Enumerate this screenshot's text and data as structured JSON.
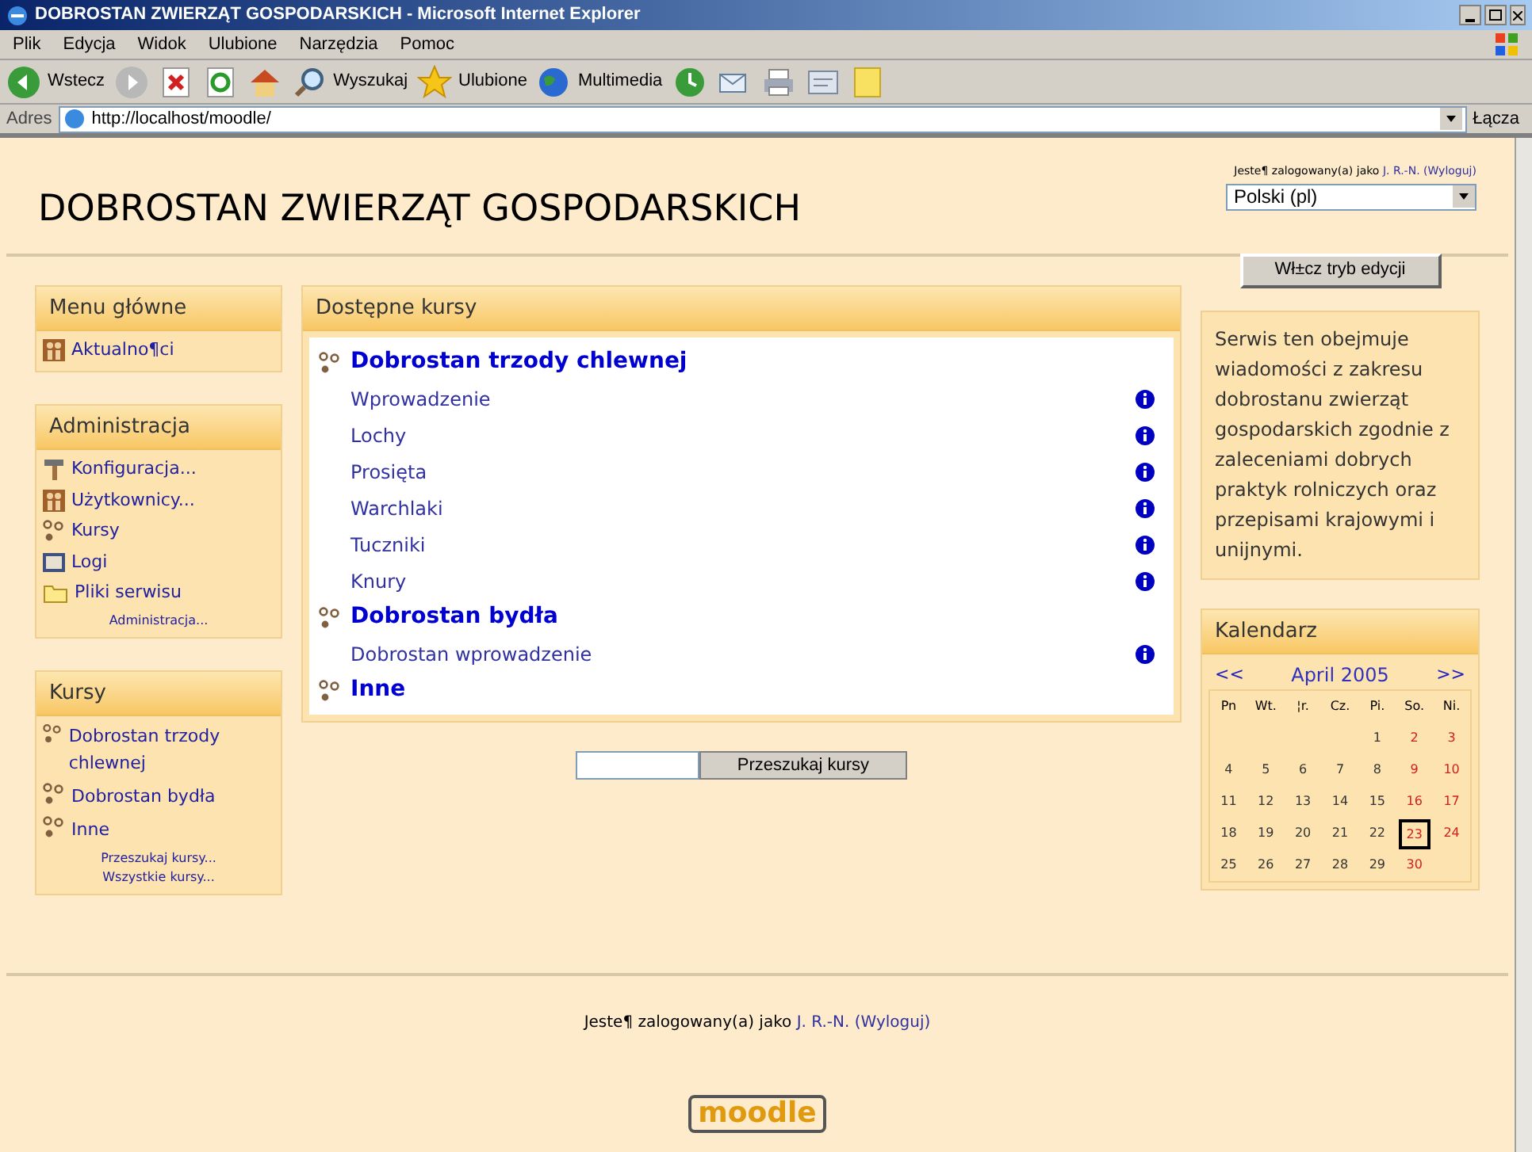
{
  "window": {
    "title": "DOBROSTAN ZWIERZĄT GOSPODARSKICH - Microsoft Internet Explorer"
  },
  "menu": [
    "Plik",
    "Edycja",
    "Widok",
    "Ulubione",
    "Narzędzia",
    "Pomoc"
  ],
  "toolbar": [
    {
      "kind": "back",
      "label": "Wstecz"
    },
    {
      "kind": "forward"
    },
    {
      "kind": "stop"
    },
    {
      "kind": "refresh"
    },
    {
      "kind": "home"
    },
    {
      "kind": "search",
      "label": "Wyszukaj"
    },
    {
      "kind": "favorites",
      "label": "Ulubione"
    },
    {
      "kind": "media",
      "label": "Multimedia"
    },
    {
      "kind": "history"
    },
    {
      "kind": "mail"
    },
    {
      "kind": "print"
    },
    {
      "kind": "edit"
    },
    {
      "kind": "notes"
    }
  ],
  "address": {
    "label": "Adres",
    "value": "http://localhost/moodle/",
    "links": "Łącza"
  },
  "site_title": "DOBROSTAN ZWIERZĄT GOSPODARSKICH",
  "login": {
    "prefix": "Jeste¶ zalogowany(a) jako",
    "user": "J. R.-N.",
    "logout": "(Wyloguj)"
  },
  "language": "Polski (pl)",
  "main_menu": {
    "title": "Menu główne",
    "items": [
      {
        "kind": "people",
        "label": "Aktualno¶ci"
      }
    ]
  },
  "admin": {
    "title": "Administracja",
    "items": [
      {
        "kind": "hammer",
        "label": "Konfiguracja..."
      },
      {
        "kind": "people",
        "label": "Użytkownicy..."
      },
      {
        "kind": "course",
        "label": "Kursy"
      },
      {
        "kind": "log",
        "label": "Logi"
      },
      {
        "kind": "folder",
        "label": "Pliki serwisu"
      }
    ],
    "more": "Administracja..."
  },
  "courses_block": {
    "title": "Kursy",
    "items": [
      "Dobrostan trzody chlewnej",
      "Dobrostan bydła",
      "Inne"
    ],
    "links": [
      "Przeszukaj kursy...",
      "Wszystkie kursy..."
    ]
  },
  "available": {
    "title": "Dostępne kursy",
    "categories": [
      {
        "name": "Dobrostan trzody chlewnej",
        "courses": [
          "Wprowadzenie",
          "Lochy",
          "Prosięta",
          "Warchlaki",
          "Tuczniki",
          "Knury"
        ]
      },
      {
        "name": "Dobrostan bydła",
        "courses": [
          "Dobrostan wprowadzenie"
        ]
      },
      {
        "name": "Inne"
      }
    ]
  },
  "search_button": "Przeszukaj kursy",
  "edit_button": "Wł±cz tryb edycji",
  "description": "Serwis ten obejmuje wiadomości z zakresu dobrostanu zwierząt gospodarskich zgodnie z zaleceniami dobrych praktyk rolniczych oraz przepisami krajowymi i unijnymi.",
  "calendar": {
    "title": "Kalendarz",
    "prev": "<<",
    "month": "April 2005",
    "next": ">>",
    "weekdays": [
      "Pn",
      "Wt.",
      "¦r.",
      "Cz.",
      "Pi.",
      "So.",
      "Ni."
    ],
    "weeks": [
      [
        {
          "kind": "blank"
        },
        {
          "kind": "blank"
        },
        {
          "kind": "blank"
        },
        {
          "kind": "blank"
        },
        {
          "day": "1",
          "weekend": false,
          "today": false
        },
        {
          "day": "2",
          "weekend": true,
          "today": false
        },
        {
          "day": "3",
          "weekend": true,
          "today": false
        }
      ],
      [
        {
          "day": "4",
          "weekend": false,
          "today": false
        },
        {
          "day": "5",
          "weekend": false,
          "today": false
        },
        {
          "day": "6",
          "weekend": false,
          "today": false
        },
        {
          "day": "7",
          "weekend": false,
          "today": false
        },
        {
          "day": "8",
          "weekend": false,
          "today": false
        },
        {
          "day": "9",
          "weekend": true,
          "today": false
        },
        {
          "day": "10",
          "weekend": true,
          "today": false
        }
      ],
      [
        {
          "day": "11",
          "weekend": false,
          "today": false
        },
        {
          "day": "12",
          "weekend": false,
          "today": false
        },
        {
          "day": "13",
          "weekend": false,
          "today": false
        },
        {
          "day": "14",
          "weekend": false,
          "today": false
        },
        {
          "day": "15",
          "weekend": false,
          "today": false
        },
        {
          "day": "16",
          "weekend": true,
          "today": false
        },
        {
          "day": "17",
          "weekend": true,
          "today": false
        }
      ],
      [
        {
          "day": "18",
          "weekend": false,
          "today": false
        },
        {
          "day": "19",
          "weekend": false,
          "today": false
        },
        {
          "day": "20",
          "weekend": false,
          "today": false
        },
        {
          "day": "21",
          "weekend": false,
          "today": false
        },
        {
          "day": "22",
          "weekend": false,
          "today": false
        },
        {
          "day": "23",
          "weekend": true,
          "today": true
        },
        {
          "day": "24",
          "weekend": true,
          "today": false
        }
      ],
      [
        {
          "day": "25",
          "weekend": false,
          "today": false
        },
        {
          "day": "26",
          "weekend": false,
          "today": false
        },
        {
          "day": "27",
          "weekend": false,
          "today": false
        },
        {
          "day": "28",
          "weekend": false,
          "today": false
        },
        {
          "day": "29",
          "weekend": false,
          "today": false
        },
        {
          "day": "30",
          "weekend": true,
          "today": false
        },
        {
          "kind": "blank"
        }
      ]
    ]
  },
  "footer_login": {
    "prefix": "Jeste¶ zalogowany(a) jako",
    "user": "J. R.-N.",
    "logout": "(Wyloguj)"
  },
  "logo": "moodle"
}
